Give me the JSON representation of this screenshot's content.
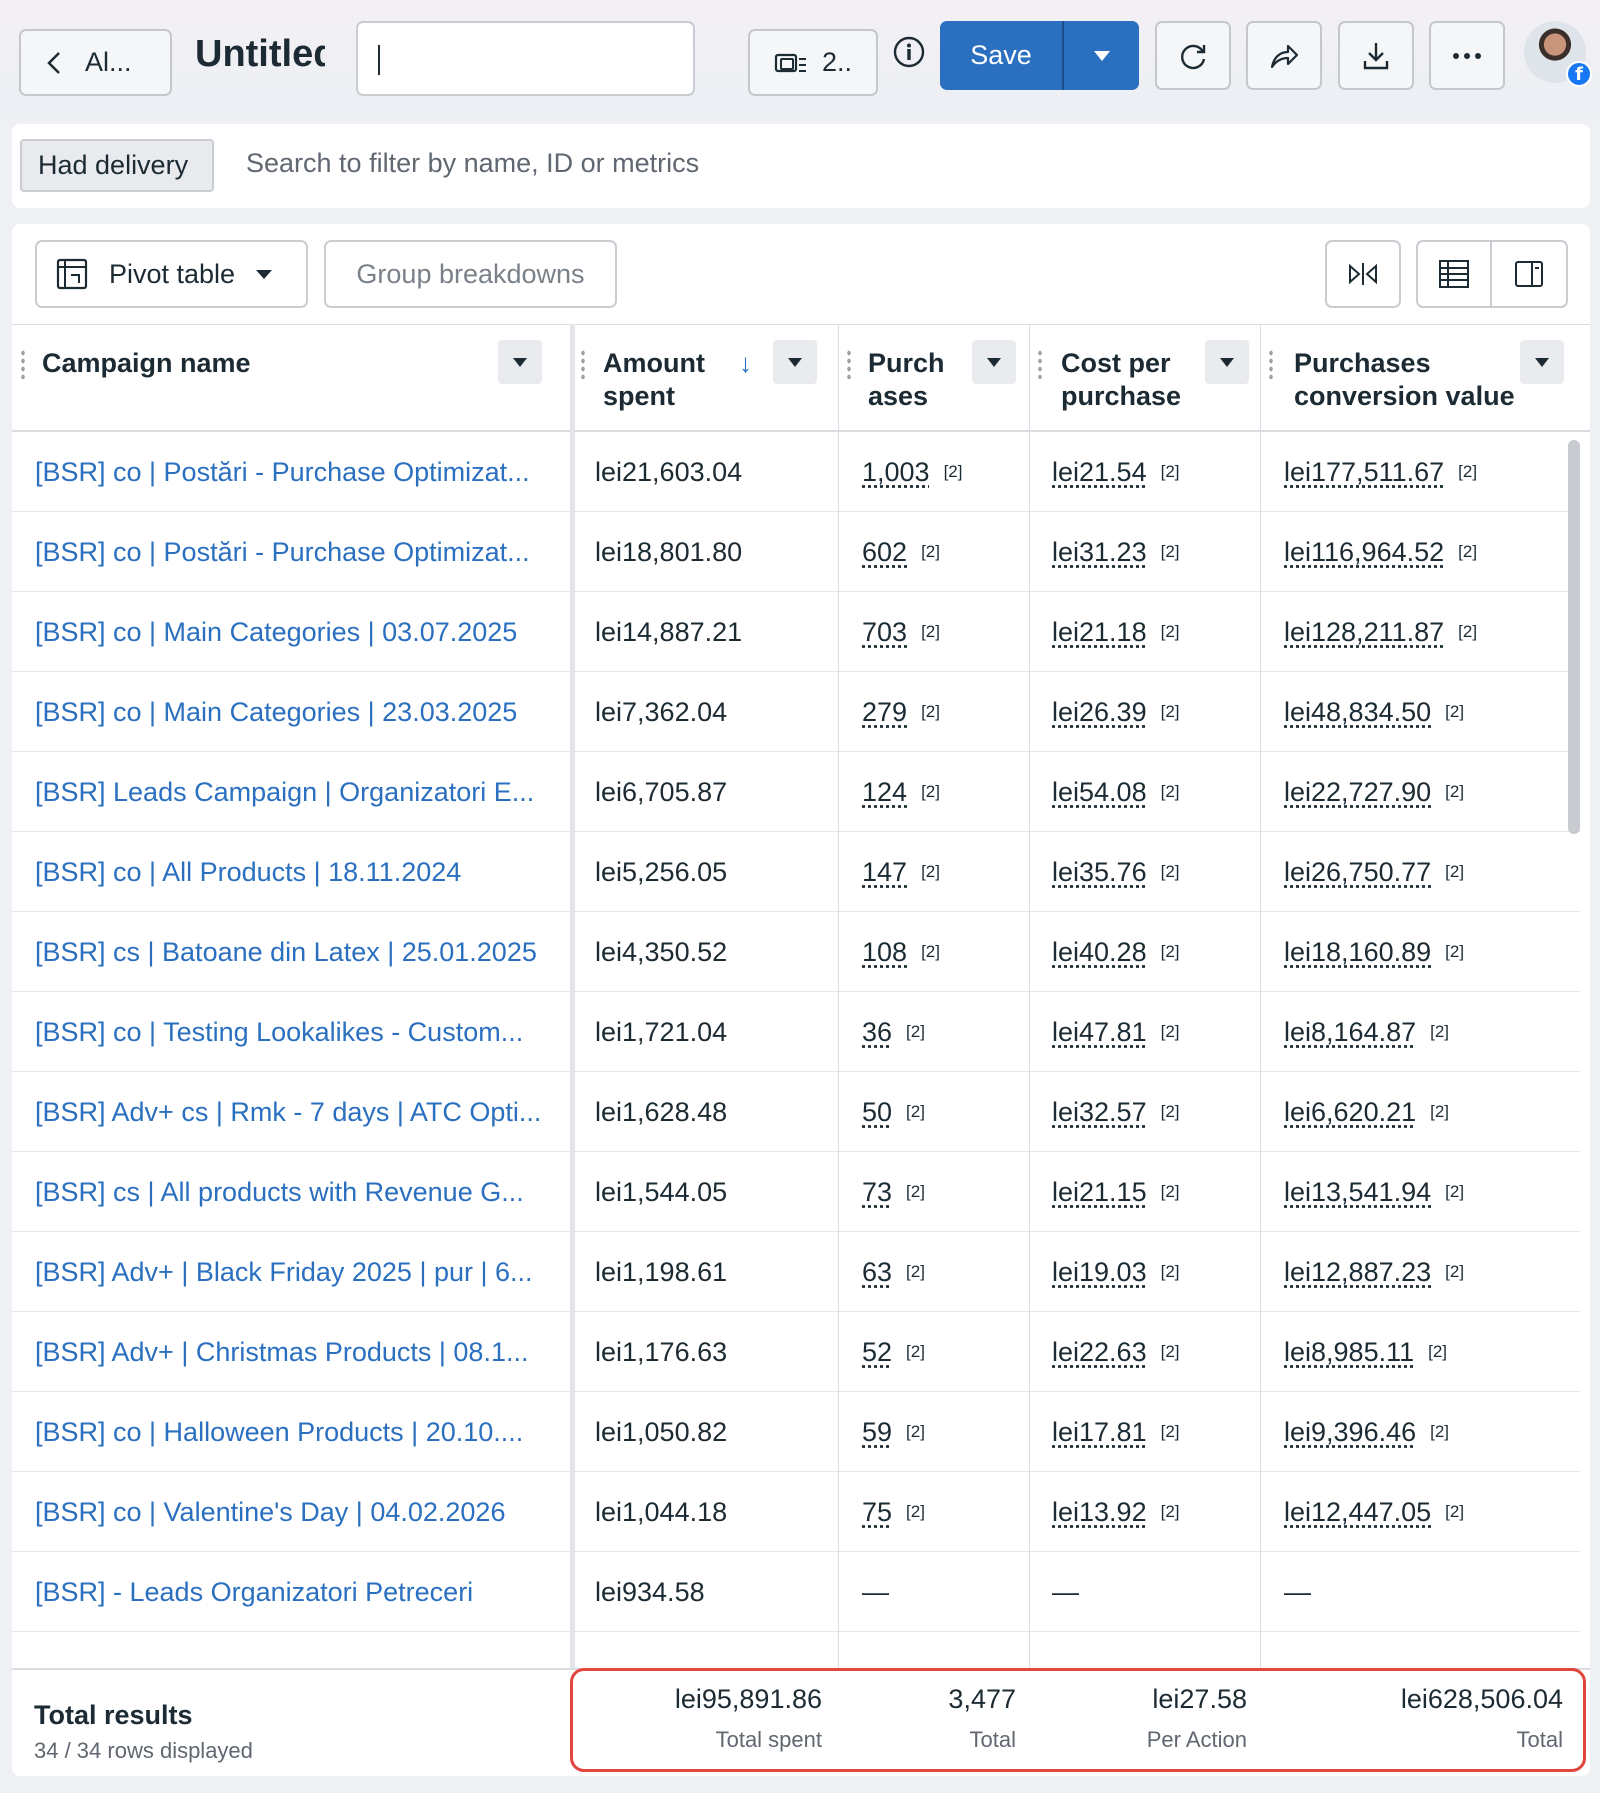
{
  "topbar": {
    "back_label": "Al...",
    "title": "Untitled",
    "views_label": "2..",
    "save_label": "Save"
  },
  "filter": {
    "chip_label": "Had delivery",
    "search_placeholder": "Search to filter by name, ID or metrics"
  },
  "toolbar": {
    "pivot_label": "Pivot table",
    "group_label": "Group breakdowns"
  },
  "columns": {
    "campaign": "Campaign name",
    "amount_1": "Amount",
    "amount_2": "spent",
    "purch_1": "Purch",
    "purch_2": "ases",
    "cpp_1": "Cost per",
    "cpp_2": "purchase",
    "pcv_1": "Purchases",
    "pcv_2": "conversion value"
  },
  "rows": [
    {
      "name": "[BSR] co | Postări - Purchase Optimizat...",
      "amount": "lei21,603.04",
      "purchases": "1,003",
      "cpp": "lei21.54",
      "value": "lei177,511.67",
      "ref": "[2]"
    },
    {
      "name": "[BSR] co | Postări - Purchase Optimizat...",
      "amount": "lei18,801.80",
      "purchases": "602",
      "cpp": "lei31.23",
      "value": "lei116,964.52",
      "ref": "[2]"
    },
    {
      "name": "[BSR] co | Main Categories | 03.07.2025",
      "amount": "lei14,887.21",
      "purchases": "703",
      "cpp": "lei21.18",
      "value": "lei128,211.87",
      "ref": "[2]"
    },
    {
      "name": "[BSR] co | Main Categories | 23.03.2025",
      "amount": "lei7,362.04",
      "purchases": "279",
      "cpp": "lei26.39",
      "value": "lei48,834.50",
      "ref": "[2]"
    },
    {
      "name": "[BSR] Leads Campaign | Organizatori E...",
      "amount": "lei6,705.87",
      "purchases": "124",
      "cpp": "lei54.08",
      "value": "lei22,727.90",
      "ref": "[2]"
    },
    {
      "name": "[BSR] co | All Products | 18.11.2024",
      "amount": "lei5,256.05",
      "purchases": "147",
      "cpp": "lei35.76",
      "value": "lei26,750.77",
      "ref": "[2]"
    },
    {
      "name": "[BSR] cs | Batoane din Latex | 25.01.2025",
      "amount": "lei4,350.52",
      "purchases": "108",
      "cpp": "lei40.28",
      "value": "lei18,160.89",
      "ref": "[2]"
    },
    {
      "name": "[BSR] co | Testing Lookalikes - Custom...",
      "amount": "lei1,721.04",
      "purchases": "36",
      "cpp": "lei47.81",
      "value": "lei8,164.87",
      "ref": "[2]"
    },
    {
      "name": "[BSR] Adv+ cs | Rmk - 7 days | ATC Opti...",
      "amount": "lei1,628.48",
      "purchases": "50",
      "cpp": "lei32.57",
      "value": "lei6,620.21",
      "ref": "[2]"
    },
    {
      "name": "[BSR] cs | All products with Revenue G...",
      "amount": "lei1,544.05",
      "purchases": "73",
      "cpp": "lei21.15",
      "value": "lei13,541.94",
      "ref": "[2]"
    },
    {
      "name": "[BSR] Adv+ | Black Friday 2025 | pur | 6...",
      "amount": "lei1,198.61",
      "purchases": "63",
      "cpp": "lei19.03",
      "value": "lei12,887.23",
      "ref": "[2]"
    },
    {
      "name": "[BSR] Adv+ | Christmas Products | 08.1...",
      "amount": "lei1,176.63",
      "purchases": "52",
      "cpp": "lei22.63",
      "value": "lei8,985.11",
      "ref": "[2]"
    },
    {
      "name": "[BSR] co | Halloween Products | 20.10....",
      "amount": "lei1,050.82",
      "purchases": "59",
      "cpp": "lei17.81",
      "value": "lei9,396.46",
      "ref": "[2]"
    },
    {
      "name": "[BSR] co | Valentine's Day | 04.02.2026",
      "amount": "lei1,044.18",
      "purchases": "75",
      "cpp": "lei13.92",
      "value": "lei12,447.05",
      "ref": "[2]"
    },
    {
      "name": "[BSR] - Leads Organizatori Petreceri",
      "amount": "lei934.58",
      "purchases": "—",
      "cpp": "—",
      "value": "—",
      "ref": ""
    }
  ],
  "footer": {
    "title": "Total results",
    "rows_displayed": "34 / 34 rows displayed",
    "amount_value": "lei95,891.86",
    "amount_label": "Total spent",
    "purch_value": "3,477",
    "purch_label": "Total",
    "cpp_value": "lei27.58",
    "cpp_label": "Per Action",
    "pcv_value": "lei628,506.04",
    "pcv_label": "Total"
  },
  "colors": {
    "accent": "#2a6fc0",
    "highlight": "#e0463b"
  }
}
